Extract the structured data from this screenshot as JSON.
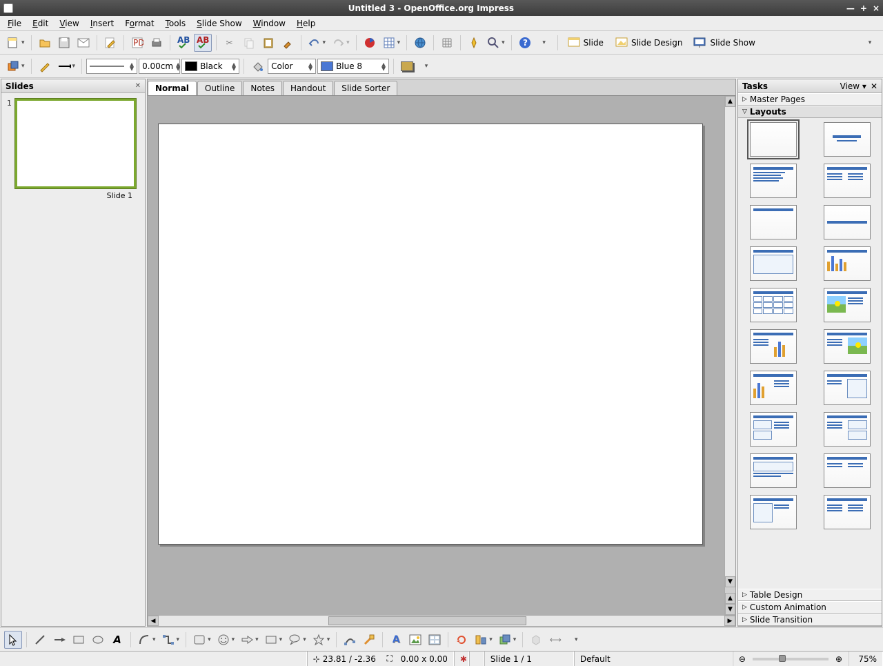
{
  "window": {
    "title": "Untitled 3 - OpenOffice.org Impress"
  },
  "menubar": {
    "file": "File",
    "edit": "Edit",
    "view": "View",
    "insert": "Insert",
    "format": "Format",
    "tools": "Tools",
    "slideshow": "Slide Show",
    "window": "Window",
    "help": "Help"
  },
  "toolbar1": {
    "slide_btn": "Slide",
    "slide_design_btn": "Slide Design",
    "slide_show_btn": "Slide Show"
  },
  "toolbar2": {
    "line_width": "0.00cm",
    "line_color_label": "Black",
    "fill_mode": "Color",
    "fill_color_label": "Blue 8"
  },
  "slides_panel": {
    "title": "Slides",
    "slide1_num": "1",
    "slide1_label": "Slide 1"
  },
  "view_tabs": {
    "normal": "Normal",
    "outline": "Outline",
    "notes": "Notes",
    "handout": "Handout",
    "slide_sorter": "Slide Sorter"
  },
  "tasks_panel": {
    "title": "Tasks",
    "view_label": "View",
    "master_pages": "Master Pages",
    "layouts": "Layouts",
    "table_design": "Table Design",
    "custom_animation": "Custom Animation",
    "slide_transition": "Slide Transition"
  },
  "statusbar": {
    "coords": "23.81 / -2.36",
    "size": "0.00 x 0.00",
    "slide_info": "Slide 1 / 1",
    "template": "Default",
    "zoom": "75%"
  },
  "colors": {
    "black": "#000000",
    "blue8": "#4a77d4",
    "shadow_swatch": "#c9a84e"
  }
}
